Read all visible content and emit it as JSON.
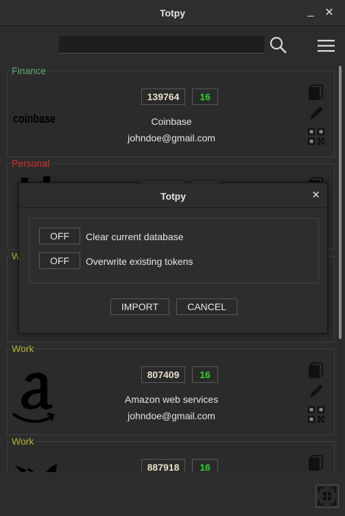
{
  "window": {
    "title": "Totpy",
    "minimize": "_",
    "close": "✕"
  },
  "toolbar": {
    "search_value": "",
    "search_icon": "search-icon",
    "menu_icon": "hamburger-menu-icon"
  },
  "entries": [
    {
      "group": "Finance",
      "group_color": "#5fae7a",
      "code": "139764",
      "timer": "16",
      "issuer": "Coinbase",
      "account": "johndoe@gmail.com",
      "logo": "coinbase"
    },
    {
      "group": "Personal",
      "group_color": "#d9312c",
      "code": "",
      "timer": "",
      "issuer": "",
      "account": "",
      "logo": ""
    },
    {
      "group": "W",
      "group_color": "#b5b23b",
      "code": "",
      "timer": "",
      "issuer": "",
      "account": "",
      "logo": ""
    },
    {
      "group": "Work",
      "group_color": "#b5b23b",
      "code": "807409",
      "timer": "16",
      "issuer": "Amazon web services",
      "account": "johndoe@gmail.com",
      "logo": "amazon"
    },
    {
      "group": "Work",
      "group_color": "#b5b23b",
      "code": "887918",
      "timer": "16",
      "issuer": "",
      "account": "",
      "logo": ""
    }
  ],
  "dialog": {
    "title": "Totpy",
    "close": "✕",
    "options": [
      {
        "state": "OFF",
        "label": "Clear current database"
      },
      {
        "state": "OFF",
        "label": "Overwrite existing tokens"
      }
    ],
    "import_label": "IMPORT",
    "cancel_label": "CANCEL"
  },
  "colors": {
    "timer": "#2ed42e",
    "code": "#e9e0cc",
    "finance": "#5fae7a",
    "personal": "#d9312c",
    "work": "#b5b23b"
  }
}
